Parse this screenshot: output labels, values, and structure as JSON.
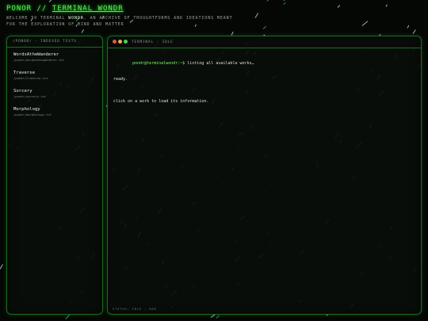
{
  "header": {
    "title_prefix": "PONOR // ",
    "title_main": "TERMINAL WONDR",
    "subtitle_part1": "Welcome to Terminal ",
    "subtitle_hl": "Wondr",
    "subtitle_part2": ", an archive of thoughtforms and ideations meant for the exploration of mind and matter"
  },
  "sidebar": {
    "header": "/ponor/ - indexed texts",
    "items": [
      {
        "name": "WordsAtheWanderer",
        "path": "/pondr/wordsathewanderer.txt"
      },
      {
        "name": "Traverse",
        "path": "/pondr/traverse.txt"
      },
      {
        "name": "Sorcery",
        "path": "/pondr/sorcery.txt"
      },
      {
        "name": "Morphology",
        "path": "/pondr/morphology.txt"
      }
    ]
  },
  "terminal": {
    "title": "terminal - idle",
    "prompt": "pondr@terminalwondr:~$",
    "command": " listing all available works…",
    "ready": "ready.",
    "hint": "click on a work to load its information.",
    "status": "status: idle - 000"
  },
  "colors": {
    "accent": "#5cf05c",
    "border": "#1e6a24",
    "background": "#050705"
  }
}
